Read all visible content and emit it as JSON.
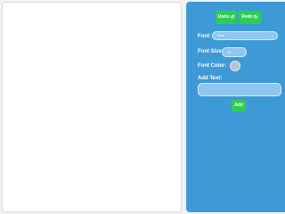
{
  "toolbar": {
    "undo_label": "Undo",
    "undo_icon": "↺",
    "redo_label": "Redo",
    "redo_icon": "↻"
  },
  "font": {
    "label": "Font:",
    "selected": "Arial",
    "icon": "chevron-down-icon"
  },
  "font_size": {
    "label": "Font Size:",
    "value": "16"
  },
  "font_color": {
    "label": "Font Color:",
    "value": "#b9c4cf"
  },
  "add_text": {
    "label": "Add Text:",
    "value": "",
    "button_label": "Add"
  },
  "colors": {
    "panel": "#3d9ad6",
    "button": "#2ecc55",
    "input": "#8ec6ef"
  }
}
